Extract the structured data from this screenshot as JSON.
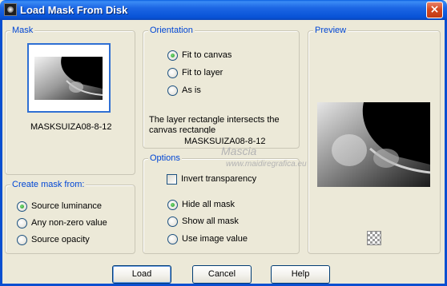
{
  "window": {
    "title": "Load Mask From Disk",
    "close_glyph": "×"
  },
  "mask": {
    "legend": "Mask",
    "filename": "MASKSUIZA08-8-12"
  },
  "create_mask_from": {
    "legend": "Create mask from:",
    "options": [
      "Source luminance",
      "Any non-zero value",
      "Source opacity"
    ],
    "selected": "Source luminance"
  },
  "orientation": {
    "legend": "Orientation",
    "options": [
      "Fit to canvas",
      "Fit to layer",
      "As is"
    ],
    "selected": "Fit to canvas",
    "info_text": "The layer rectangle intersects the canvas rectangle",
    "mask_name": "MASKSUIZA08-8-12"
  },
  "options": {
    "legend": "Options",
    "invert_label": "Invert transparency",
    "invert_checked": false,
    "mask_options": [
      "Hide all mask",
      "Show all mask",
      "Use image value"
    ],
    "selected": "Hide all mask"
  },
  "preview": {
    "legend": "Preview",
    "toggle_icon": "checkerboard-icon"
  },
  "watermark": {
    "name": "Mascia",
    "url": "www.maidiregrafica.eu"
  },
  "buttons": {
    "load": "Load",
    "cancel": "Cancel",
    "help": "Help"
  },
  "colors": {
    "title_bar": "#0a5fe0",
    "legend_text": "#0046d5",
    "dialog_bg": "#ece9d8",
    "close_button": "#d44a22",
    "radio_dot": "#1e9a1e"
  }
}
